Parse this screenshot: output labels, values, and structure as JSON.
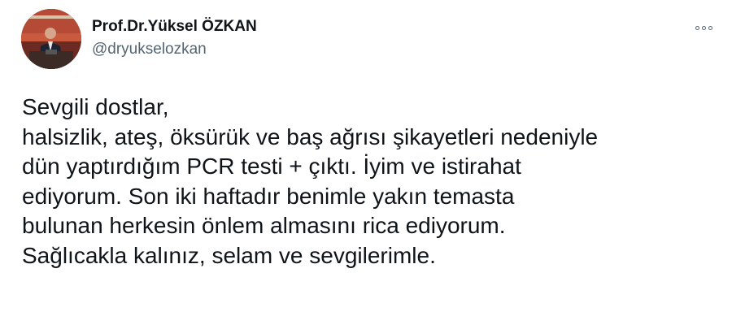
{
  "tweet": {
    "author_name": "Prof.Dr.Yüksel ÖZKAN",
    "author_handle": "@dryukselozkan",
    "text": "Sevgili dostlar,\nhalsizlik, ateş, öksürük ve baş ağrısı şikayetleri nedeniyle\ndün yaptırdığım PCR testi + çıktı. İyim ve istirahat\nediyorum. Son iki haftadır benimle yakın temasta\nbulunan herkesin önlem almasını rica ediyorum.\nSağlıcakla kalınız, selam ve sevgilerimle.",
    "more_icon": "more-options-icon"
  },
  "colors": {
    "primary_text": "#0f1419",
    "secondary_text": "#536471",
    "background": "#ffffff"
  }
}
